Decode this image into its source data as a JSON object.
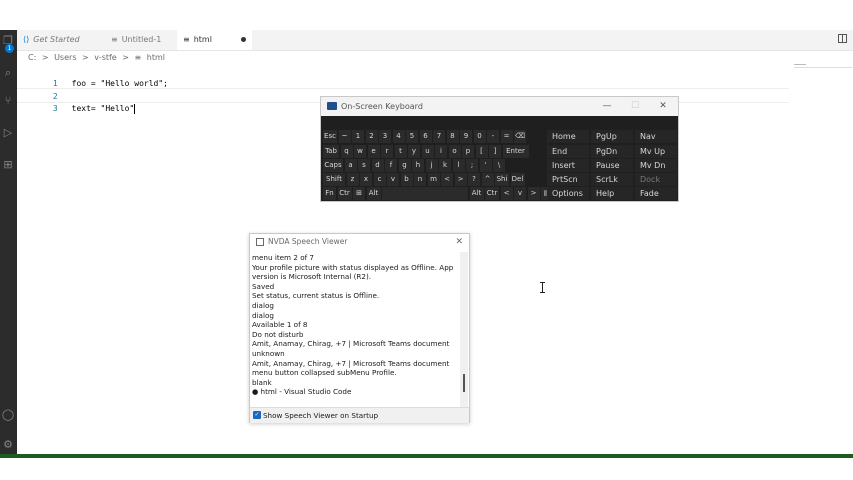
{
  "tabs": [
    {
      "label": "Get Started",
      "icon": "vscode-icon",
      "active": false
    },
    {
      "label": "Untitled-1",
      "icon": "text-file-icon",
      "active": false
    },
    {
      "label": "html",
      "icon": "text-file-icon",
      "active": true,
      "dirty": true
    }
  ],
  "activity_badge": "1",
  "breadcrumb": [
    "C:",
    ">",
    "Users",
    ">",
    "v-stfe",
    ">",
    "html"
  ],
  "editor": {
    "lines": [
      {
        "num": "1",
        "code": "foo = \"Hello world\";"
      },
      {
        "num": "2",
        "code": ""
      },
      {
        "num": "3",
        "code": "text= \"Hello\""
      }
    ]
  },
  "osk": {
    "title": "On-Screen Keyboard",
    "minimize": "—",
    "maximize": "☐",
    "close": "✕",
    "rows": [
      [
        "Esc",
        "~",
        "1",
        "2",
        "3",
        "4",
        "5",
        "6",
        "7",
        "8",
        "9",
        "0",
        "-",
        "=",
        "⌫"
      ],
      [
        "Tab",
        "q",
        "w",
        "e",
        "r",
        "t",
        "y",
        "u",
        "i",
        "o",
        "p",
        "[",
        "]",
        "Enter"
      ],
      [
        "Caps",
        "a",
        "s",
        "d",
        "f",
        "g",
        "h",
        "j",
        "k",
        "l",
        ";",
        "'",
        "\\"
      ],
      [
        "Shift",
        "z",
        "x",
        "c",
        "v",
        "b",
        "n",
        "m",
        "<",
        ">",
        "?",
        "^",
        "Shi",
        "Del"
      ],
      [
        "Fn",
        "Ctr",
        "⊞",
        "Alt",
        "",
        "Alt",
        "Ctr",
        "<",
        "v",
        ">",
        "▤"
      ]
    ],
    "nav": [
      [
        "Home",
        "PgUp",
        "Nav"
      ],
      [
        "End",
        "PgDn",
        "Mv Up"
      ],
      [
        "Insert",
        "Pause",
        "Mv Dn"
      ],
      [
        "PrtScn",
        "ScrLk",
        "Dock"
      ],
      [
        "Options",
        "Help",
        "Fade"
      ]
    ]
  },
  "nvda": {
    "title": "NVDA Speech Viewer",
    "close": "✕",
    "lines": [
      "menu item  2 of 7",
      "Your profile picture with status displayed as Offline. App",
      "version is Microsoft Internal (R2).",
      "Saved",
      "Set status, current status is Offline.",
      "dialog",
      "dialog",
      "Available  1 of 8",
      "Do not disturb",
      "Amit, Anamay, Chirag, +7 | Microsoft Teams  document",
      "unknown",
      "Amit, Anamay, Chirag, +7 | Microsoft Teams  document",
      "menu button  collapsed  subMenu    Profile.",
      "blank",
      "● html - Visual Studio Code"
    ],
    "footer_checkbox": "Show Speech Viewer on Startup"
  },
  "colors": {
    "activity_bar": "#2c2c2c",
    "accent": "#0078d4",
    "osk_bg": "#1f1f1f",
    "stripe": "#1e5b1e"
  }
}
